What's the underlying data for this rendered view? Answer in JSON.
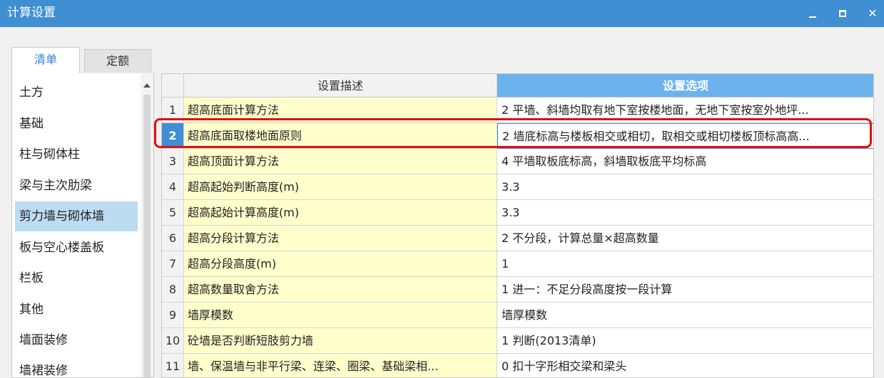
{
  "window": {
    "title": "计算设置"
  },
  "tabs": [
    {
      "label": "清单",
      "active": true
    },
    {
      "label": "定额",
      "active": false
    }
  ],
  "sidebar": {
    "items": [
      {
        "label": "土方"
      },
      {
        "label": "基础"
      },
      {
        "label": "柱与砌体柱"
      },
      {
        "label": "梁与主次肋梁"
      },
      {
        "label": "剪力墙与砌体墙",
        "selected": true
      },
      {
        "label": "板与空心楼盖板"
      },
      {
        "label": "栏板"
      },
      {
        "label": "其他"
      },
      {
        "label": "墙面装修"
      },
      {
        "label": "墙裙装修"
      }
    ]
  },
  "grid": {
    "columns": {
      "desc": "设置描述",
      "option": "设置选项"
    },
    "rows": [
      {
        "num": "1",
        "desc": "超高底面计算方法",
        "option": "2 平墙、斜墙均取有地下室按楼地面，无地下室按室外地坪..."
      },
      {
        "num": "2",
        "desc": "超高底面取楼地面原则",
        "option": "2 墙底标高与楼板相交或相切，取相交或相切楼板顶标高高..."
      },
      {
        "num": "3",
        "desc": "超高顶面计算方法",
        "option": "4 平墙取板底标高，斜墙取板底平均标高"
      },
      {
        "num": "4",
        "desc": "超高起始判断高度(m)",
        "option": "3.3"
      },
      {
        "num": "5",
        "desc": "超高起始计算高度(m)",
        "option": "3.3"
      },
      {
        "num": "6",
        "desc": "超高分段计算方法",
        "option": "2 不分段，计算总量×超高数量"
      },
      {
        "num": "7",
        "desc": "超高分段高度(m)",
        "option": "1"
      },
      {
        "num": "8",
        "desc": "超高数量取舍方法",
        "option": "1 进一：不足分段高度按一段计算"
      },
      {
        "num": "9",
        "desc": "墙厚模数",
        "option": "墙厚模数"
      },
      {
        "num": "10",
        "desc": "砼墙是否判断短肢剪力墙",
        "option": "1 判断(2013清单)"
      },
      {
        "num": "11",
        "desc": "墙、保温墙与非平行梁、连梁、圈梁、基础梁相...",
        "option": "0 扣十字形相交梁和梁头"
      }
    ],
    "active_row": 1
  },
  "colors": {
    "titlebar": "#3f8fd2",
    "header_option": "#6cb3ee",
    "desc_cell": "#ffffcc",
    "selected_sidebar": "#bcdcf2",
    "highlight_box": "#e01010"
  }
}
